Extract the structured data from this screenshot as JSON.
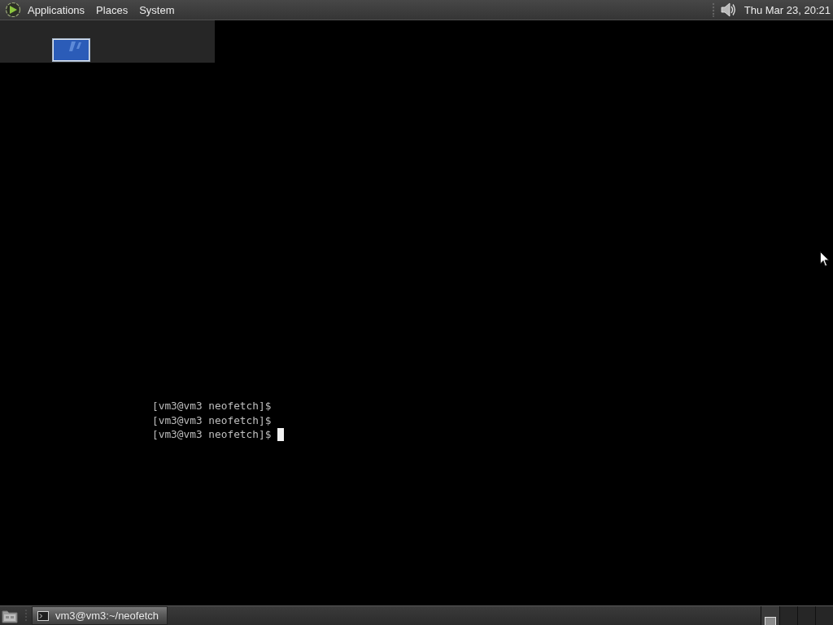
{
  "top_panel": {
    "menus": [
      {
        "label": "Applications"
      },
      {
        "label": "Places"
      },
      {
        "label": "System"
      }
    ],
    "clock": "Thu Mar 23, 20:21"
  },
  "terminal": {
    "lines": [
      {
        "text": "[vm3@vm3 neofetch]$",
        "cursor": false
      },
      {
        "text": "[vm3@vm3 neofetch]$",
        "cursor": false
      },
      {
        "text": "[vm3@vm3 neofetch]$",
        "cursor": true
      }
    ]
  },
  "bottom_panel": {
    "tasks": [
      {
        "label": "vm3@vm3:~/neofetch",
        "selected": true
      }
    ],
    "workspaces": [
      {
        "selected": true,
        "has_window": true
      },
      {
        "selected": false,
        "has_window": false
      },
      {
        "selected": false,
        "has_window": false
      },
      {
        "selected": false,
        "has_window": false
      }
    ]
  }
}
